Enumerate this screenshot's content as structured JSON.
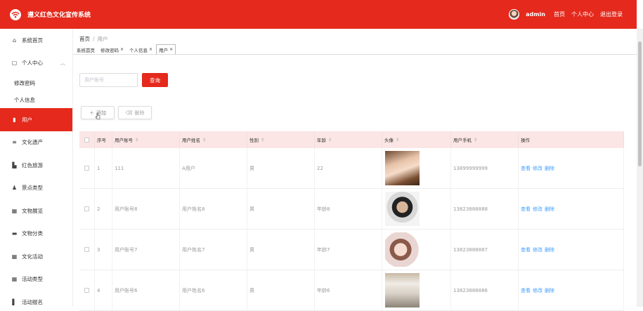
{
  "header": {
    "app_title": "遵义红色文化宣传系统",
    "admin": "admin",
    "nav": [
      "首页",
      "个人中心",
      "退出登录"
    ]
  },
  "sidebar": {
    "items": [
      {
        "label": "系统首页",
        "icon": "home-icon"
      },
      {
        "label": "个人中心",
        "icon": "calendar-icon"
      },
      {
        "label": "修改密码",
        "sub": true
      },
      {
        "label": "个人信息",
        "sub": true
      },
      {
        "label": "用户",
        "icon": "clipboard-icon",
        "active": true
      },
      {
        "label": "文化遗产",
        "icon": "list-icon"
      },
      {
        "label": "红色旅游",
        "icon": "landmark-icon"
      },
      {
        "label": "景点类型",
        "icon": "user-icon"
      },
      {
        "label": "文物展览",
        "icon": "grid-icon"
      },
      {
        "label": "文物分类",
        "icon": "tag-icon"
      },
      {
        "label": "文化活动",
        "icon": "grid-icon"
      },
      {
        "label": "活动类型",
        "icon": "grid-icon"
      },
      {
        "label": "活动报名",
        "icon": "book-icon"
      }
    ]
  },
  "breadcrumb": {
    "home": "首页",
    "current": "用户"
  },
  "tabs": [
    {
      "label": "系统首页",
      "closable": false
    },
    {
      "label": "修改密码",
      "closable": true
    },
    {
      "label": "个人信息",
      "closable": true
    },
    {
      "label": "用户",
      "closable": true,
      "active": true
    }
  ],
  "search": {
    "placeholder": "用户账号",
    "button": "查询"
  },
  "actions": {
    "add": "添加",
    "delete": "删除"
  },
  "table": {
    "columns": [
      "序号",
      "用户账号",
      "用户姓名",
      "性别",
      "年龄",
      "头像",
      "用户手机",
      "操作"
    ],
    "rows": [
      {
        "idx": "1",
        "account": "111",
        "name": "A用户",
        "gender": "男",
        "age": "22",
        "phone": "13899999999"
      },
      {
        "idx": "2",
        "account": "用户账号8",
        "name": "用户姓名8",
        "gender": "男",
        "age": "年龄8",
        "phone": "13823888888"
      },
      {
        "idx": "3",
        "account": "用户账号7",
        "name": "用户姓名7",
        "gender": "男",
        "age": "年龄7",
        "phone": "13823888887"
      },
      {
        "idx": "4",
        "account": "用户账号6",
        "name": "用户姓名6",
        "gender": "男",
        "age": "年龄6",
        "phone": "13823888886"
      }
    ],
    "ops": [
      "查看",
      "修改",
      "删除"
    ]
  }
}
